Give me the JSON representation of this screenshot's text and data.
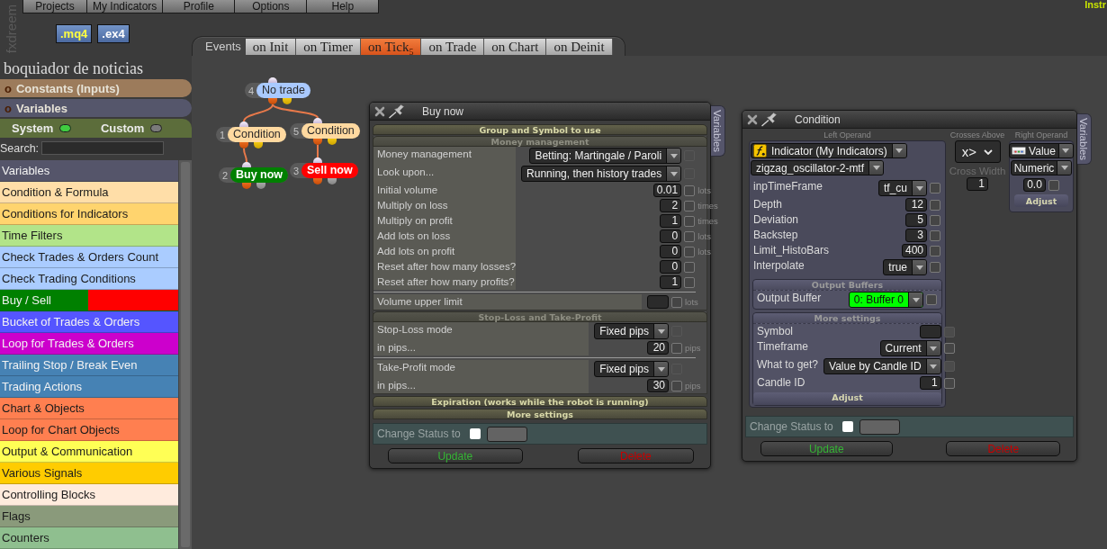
{
  "app": {
    "logo": "fxdreem",
    "corner_label": "Instr"
  },
  "menu": [
    {
      "label": "Projects"
    },
    {
      "label": "My Indicators"
    },
    {
      "label": "Profile"
    },
    {
      "label": "Options"
    },
    {
      "label": "Help"
    }
  ],
  "file_buttons": [
    {
      "label": ".mq4",
      "kind": "source"
    },
    {
      "label": ".ex4",
      "kind": "compiled"
    }
  ],
  "events": {
    "label": "Events",
    "tabs": [
      {
        "label": "on Init",
        "selected": false
      },
      {
        "label": "on Timer",
        "selected": false
      },
      {
        "label": "on Tick$_{5}$",
        "selected": true
      },
      {
        "label": "on Trade",
        "selected": false
      },
      {
        "label": "on Chart",
        "selected": false
      },
      {
        "label": "on Deinit",
        "selected": false
      }
    ]
  },
  "sidebar": {
    "project_title": "boquiador de noticias",
    "panels": [
      {
        "marker": "o",
        "label": "Constants (Inputs)",
        "color": "#9c7b5b"
      },
      {
        "marker": "o",
        "label": "Variables",
        "color": "#55566b"
      }
    ],
    "scopes": [
      {
        "label": "System",
        "on": true
      },
      {
        "label": "Custom",
        "on": false
      }
    ],
    "search": {
      "label": "Search:"
    },
    "categories": [
      {
        "label": "Variables",
        "color": "#55556a"
      },
      {
        "label": "Condition & Formula",
        "color": "#ffdea8"
      },
      {
        "label": "Conditions for Indicators",
        "color": "#ffd46e"
      },
      {
        "label": "Time Filters",
        "color": "#b2e489"
      },
      {
        "label": "Check Trades & Orders Count",
        "color": "#aaccff"
      },
      {
        "label": "Check Trading Conditions",
        "color": "#aaccff"
      },
      {
        "label": "Buy / Sell",
        "color": "#008000",
        "split": {
          "color": "#ff0000"
        }
      },
      {
        "label": "Bucket of Trades & Orders",
        "color": "#5555ff"
      },
      {
        "label": "Loop for Trades & Orders",
        "color": "#cc00cc"
      },
      {
        "label": "Trailing Stop / Break Even",
        "color": "#4682b4"
      },
      {
        "label": "Trading Actions",
        "color": "#4682b4"
      },
      {
        "label": "Chart & Objects",
        "color": "#ff7f50"
      },
      {
        "label": "Loop for Chart Objects",
        "color": "#ff7f50"
      },
      {
        "label": "Output & Communication",
        "color": "#ffff55"
      },
      {
        "label": "Various Signals",
        "color": "#ffcc00"
      },
      {
        "label": "Controlling Blocks",
        "color": "#ffebdd"
      },
      {
        "label": "Flags",
        "color": "#8a9a7b"
      },
      {
        "label": "Counters",
        "color": "#8fbf8f"
      }
    ]
  },
  "diagram": {
    "blocks": [
      {
        "number": "4",
        "label": "No trade",
        "kind": "filter",
        "color": "#a9c9ff",
        "children": [
          {
            "number": "1",
            "label": "Condition",
            "kind": "filter",
            "color": "#ffd9a0",
            "children": [
              {
                "number": "2",
                "label": "Buy now",
                "kind": "action",
                "color": "#008000"
              }
            ]
          },
          {
            "number": "5",
            "label": "Condition",
            "kind": "filter",
            "color": "#ffd9a0",
            "children": [
              {
                "number": "3",
                "label": "Sell now",
                "kind": "action",
                "color": "#ff0000"
              }
            ]
          }
        ]
      }
    ]
  },
  "buy_window": {
    "title": "Buy now",
    "side_tab": "Variables",
    "sections": [
      {
        "title": "Group and Symbol to use",
        "expanded": false
      },
      {
        "title": "Money management",
        "expanded": true,
        "groups": [
          {
            "rows": [
              {
                "kind": "select",
                "label": "Money management",
                "value": "Betting: Martingale / Paroli",
                "checkbox": {
                  "checked": false,
                  "disabled": true
                }
              },
              {
                "kind": "select",
                "label": "Look upon...",
                "value": "Running, then history trades",
                "checkbox": {
                  "checked": false,
                  "disabled": true
                }
              },
              {
                "kind": "number",
                "label": "Initial volume",
                "value": "0.01",
                "unit": "lots",
                "checkbox": {
                  "checked": false,
                  "disabled": false
                }
              },
              {
                "kind": "number",
                "label": "Multiply on loss",
                "value": "2",
                "unit": "times",
                "checkbox": {
                  "checked": false,
                  "disabled": false
                }
              },
              {
                "kind": "number",
                "label": "Multiply on profit",
                "value": "1",
                "unit": "times",
                "checkbox": {
                  "checked": false,
                  "disabled": false
                }
              },
              {
                "kind": "number",
                "label": "Add lots on loss",
                "value": "0",
                "unit": "lots",
                "checkbox": {
                  "checked": false,
                  "disabled": false
                }
              },
              {
                "kind": "number",
                "label": "Add lots on profit",
                "value": "0",
                "unit": "lots",
                "checkbox": {
                  "checked": false,
                  "disabled": false
                }
              },
              {
                "kind": "number",
                "label": "Reset after how many losses?",
                "value": "0",
                "checkbox": {
                  "checked": false,
                  "disabled": false
                }
              },
              {
                "kind": "number",
                "label": "Reset after how many profits?",
                "value": "1",
                "checkbox": {
                  "checked": false,
                  "disabled": false
                }
              }
            ]
          },
          {
            "rows": [
              {
                "kind": "number",
                "label": "Volume upper limit",
                "unit": "lots",
                "checkbox": {
                  "checked": false,
                  "disabled": false
                }
              }
            ]
          }
        ]
      },
      {
        "title": "Stop-Loss and Take-Profit",
        "expanded": true,
        "groups": [
          {
            "rows": [
              {
                "kind": "select",
                "label": "Stop-Loss mode",
                "value": "Fixed pips",
                "checkbox": {
                  "checked": false,
                  "disabled": true
                }
              },
              {
                "kind": "number",
                "label": "in pips...",
                "value": "20",
                "unit": "pips",
                "checkbox": {
                  "checked": false,
                  "disabled": false
                }
              }
            ]
          },
          {
            "rows": [
              {
                "kind": "select",
                "label": "Take-Profit mode",
                "value": "Fixed pips",
                "checkbox": {
                  "checked": false,
                  "disabled": true
                }
              },
              {
                "kind": "number",
                "label": "in pips...",
                "value": "30",
                "unit": "pips",
                "checkbox": {
                  "checked": false,
                  "disabled": false
                }
              }
            ]
          }
        ]
      },
      {
        "title": "Expiration (works while the robot is running)",
        "expanded": false
      },
      {
        "title": "More settings",
        "expanded": false
      }
    ],
    "status": {
      "label": "Change Status to",
      "checked": false
    },
    "buttons": [
      {
        "label": "Update",
        "kind": "update"
      },
      {
        "label": "Delete",
        "kind": "delete"
      }
    ]
  },
  "condition_window": {
    "title": "Condition",
    "side_tab": "Variables",
    "left_operand": {
      "heading": "Left Operand",
      "source": "Indicator (My Indicators)",
      "indicator": "zigzag_oscillator-2-mtf",
      "params": [
        {
          "kind": "select",
          "label": "inpTimeFrame",
          "value": "tf_cu",
          "checkbox": {
            "checked": false,
            "disabled": false
          }
        },
        {
          "kind": "number",
          "label": "Depth",
          "value": "12",
          "checkbox": {
            "checked": false,
            "disabled": false
          }
        },
        {
          "kind": "number",
          "label": "Deviation",
          "value": "5",
          "checkbox": {
            "checked": false,
            "disabled": false
          }
        },
        {
          "kind": "number",
          "label": "Backstep",
          "value": "3",
          "checkbox": {
            "checked": false,
            "disabled": false
          }
        },
        {
          "kind": "number",
          "label": "Limit_HistoBars",
          "value": "400",
          "checkbox": {
            "checked": false,
            "disabled": false
          }
        },
        {
          "kind": "select",
          "label": "Interpolate",
          "value": "true",
          "checkbox": {
            "checked": false,
            "disabled": false
          }
        }
      ],
      "groups": [
        {
          "title": "Output Buffers",
          "rows": [
            {
              "kind": "select",
              "label": "Output Buffer",
              "value": "0: Buffer 0",
              "color": "#00ff00",
              "checkbox": {
                "checked": false,
                "disabled": false
              }
            }
          ]
        },
        {
          "title": "More settings",
          "rows": [
            {
              "kind": "text",
              "label": "Symbol",
              "checkbox": {
                "checked": false,
                "disabled": true
              }
            },
            {
              "kind": "select",
              "label": "Timeframe",
              "value": "Current",
              "checkbox": {
                "checked": false,
                "disabled": false
              }
            },
            {
              "kind": "select",
              "label": "What to get?",
              "value": "Value by Candle ID",
              "checkbox": {
                "checked": false,
                "disabled": true
              }
            },
            {
              "kind": "number",
              "label": "Candle ID",
              "value": "1",
              "checkbox": {
                "checked": false,
                "disabled": false
              }
            }
          ],
          "action": "Adjust"
        }
      ]
    },
    "operator": {
      "heading": "Crosses Above",
      "value": "x>",
      "width_label": "Cross Width",
      "width_value": "1"
    },
    "right_operand": {
      "heading": "Right Operand",
      "source": "Value",
      "type": "Numeric",
      "value": "0.0",
      "checkbox": {
        "checked": false,
        "disabled": false
      },
      "action": "Adjust"
    },
    "status": {
      "label": "Change Status to",
      "checked": false
    },
    "buttons": [
      {
        "label": "Update",
        "kind": "update"
      },
      {
        "label": "Delete",
        "kind": "delete"
      }
    ]
  }
}
